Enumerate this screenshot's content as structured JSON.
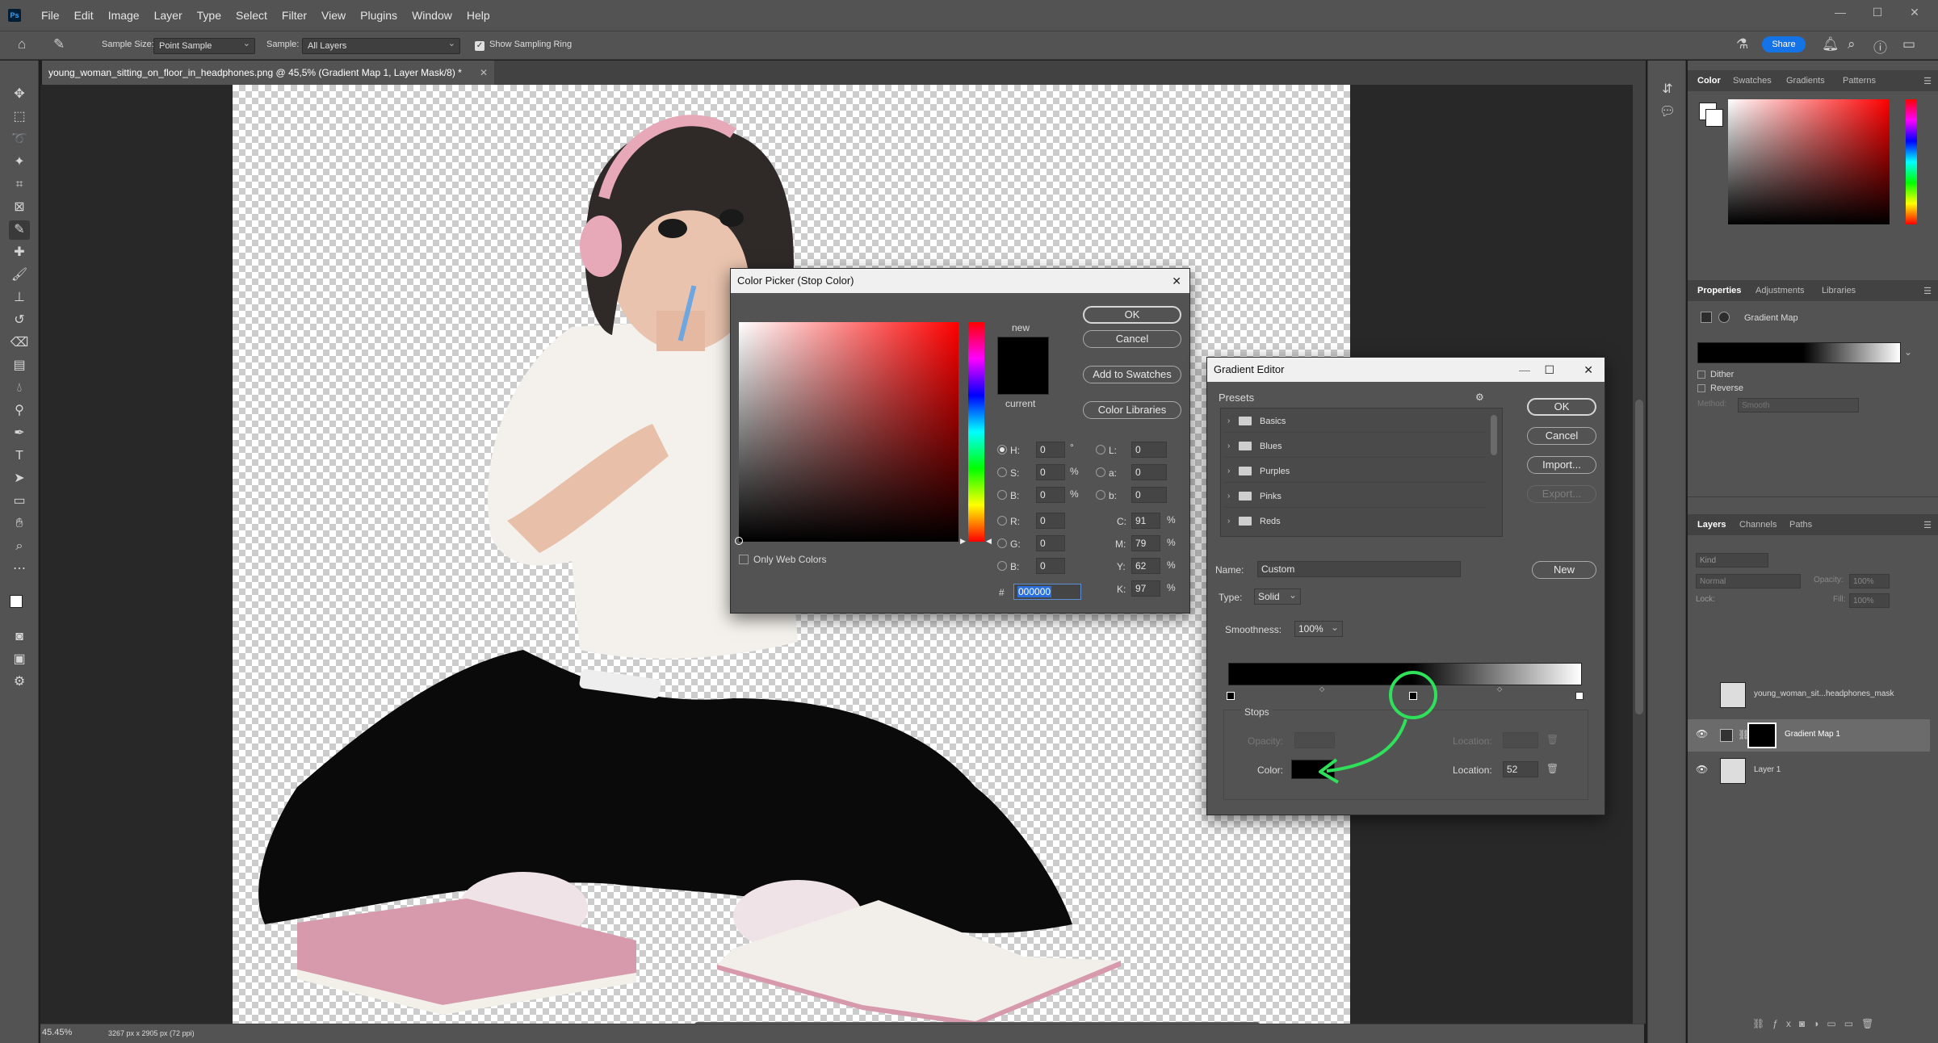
{
  "app": {
    "logo_text": "Ps",
    "menu": [
      "File",
      "Edit",
      "Image",
      "Layer",
      "Type",
      "Select",
      "Filter",
      "View",
      "Plugins",
      "Window",
      "Help"
    ]
  },
  "options_bar": {
    "sample_size_label": "Sample Size:",
    "sample_size_value": "Point Sample",
    "sample_label": "Sample:",
    "sample_value": "All Layers",
    "show_sampling_ring_label": "Show Sampling Ring",
    "show_sampling_ring_checked": true,
    "share_label": "Share"
  },
  "document": {
    "tab_title": "young_woman_sitting_on_floor_in_headphones.png @ 45,5% (Gradient Map 1, Layer Mask/8) *",
    "zoom": "45.45%",
    "dimensions": "3267 px x 2905 px (72 ppi)"
  },
  "color_picker": {
    "title": "Color Picker (Stop Color)",
    "ok_label": "OK",
    "cancel_label": "Cancel",
    "add_swatches_label": "Add to Swatches",
    "color_libraries_label": "Color Libraries",
    "new_label": "new",
    "current_label": "current",
    "only_web_colors_label": "Only Web Colors",
    "new_color": "#000000",
    "current_color": "#000000",
    "hue_base_color": "#ff0000",
    "fields": {
      "H": "0",
      "S": "0",
      "B": "0",
      "R": "0",
      "G": "0",
      "B2": "0",
      "L": "0",
      "a": "0",
      "b": "0",
      "C": "91",
      "M": "79",
      "Y": "62",
      "K": "97"
    },
    "hex_label": "#",
    "hex": "000000",
    "deg_unit": "°",
    "pct_unit": "%"
  },
  "gradient_editor": {
    "title": "Gradient Editor",
    "presets_label": "Presets",
    "preset_folders": [
      "Basics",
      "Blues",
      "Purples",
      "Pinks",
      "Reds"
    ],
    "ok_label": "OK",
    "cancel_label": "Cancel",
    "import_label": "Import...",
    "export_label": "Export...",
    "name_label": "Name:",
    "name_value": "Custom",
    "new_label": "New",
    "type_label": "Type:",
    "type_value": "Solid",
    "smoothness_label": "Smoothness:",
    "smoothness_value": "100%",
    "stops_label": "Stops",
    "opacity_label": "Opacity:",
    "location_label": "Location:",
    "color_label": "Color:",
    "color_location_value": "52",
    "stop_color": "#000000",
    "highlight_color": "#2ee05a"
  },
  "color_panel": {
    "tabs": [
      "Color",
      "Swatches",
      "Gradients",
      "Patterns"
    ],
    "foreground": "#ffffff",
    "background": "#ffffff"
  },
  "properties_panel": {
    "tabs": [
      "Properties",
      "Adjustments",
      "Libraries"
    ],
    "type_label": "Gradient Map",
    "dither_label": "Dither",
    "reverse_label": "Reverse",
    "method_label": "Method:",
    "method_value": "Smooth"
  },
  "layers_panel": {
    "tabs": [
      "Layers",
      "Channels",
      "Paths"
    ],
    "filter_placeholder": "Kind",
    "blend_mode": "Normal",
    "opacity_label": "Opacity:",
    "opacity_value": "100%",
    "lock_label": "Lock:",
    "fill_label": "Fill:",
    "fill_value": "100%",
    "layers": [
      {
        "name": "young_woman_sit...headphones_mask",
        "visible": false
      },
      {
        "name": "Gradient Map 1",
        "visible": true
      },
      {
        "name": "Layer 1",
        "visible": true
      }
    ]
  }
}
